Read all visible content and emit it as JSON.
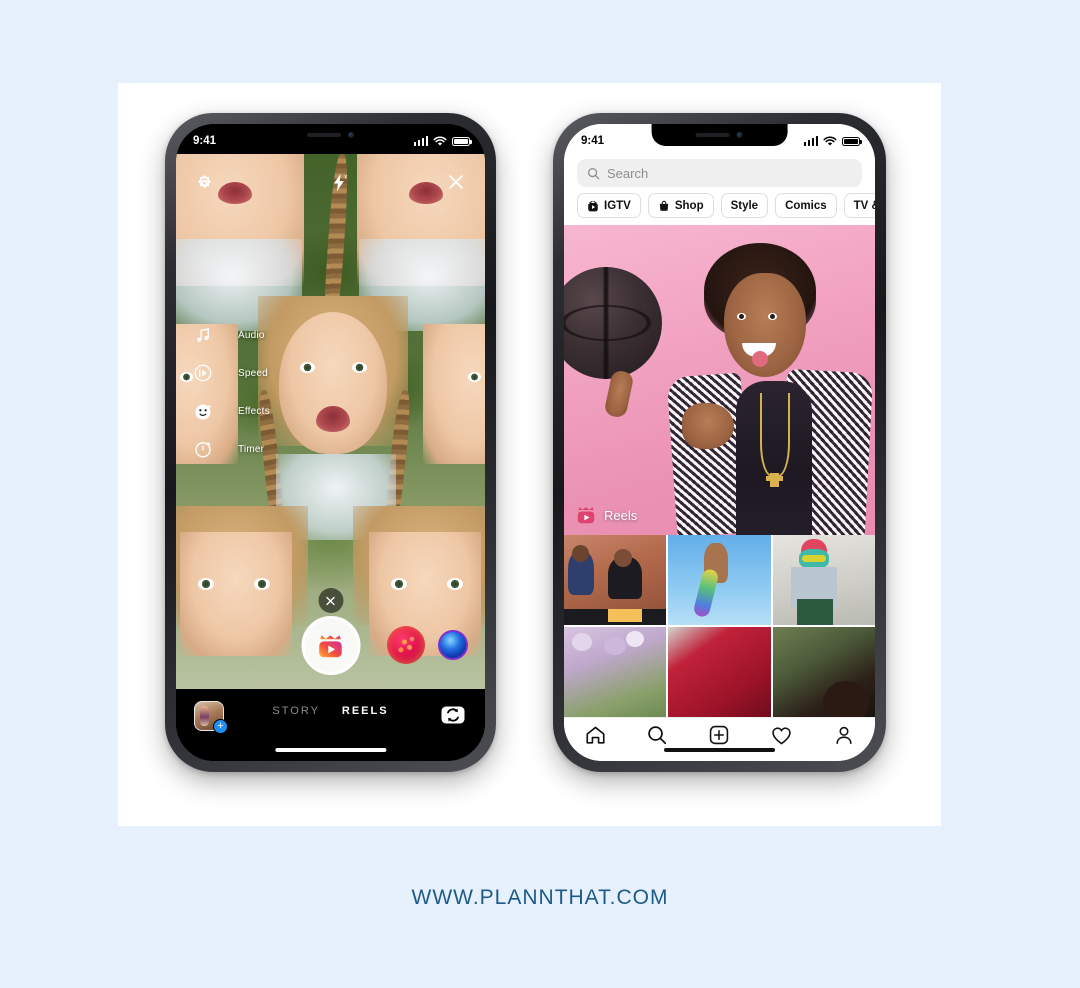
{
  "page": {
    "background_color": "#e7f1fd",
    "card_background": "#ffffff",
    "footer_url": "WWW.PLANNTHAT.COM",
    "footer_color": "#1d5b88"
  },
  "left_phone": {
    "name": "instagram-reels-camera",
    "status_bar": {
      "time": "9:41",
      "signal": "signal-bars-icon",
      "wifi": "wifi-icon",
      "battery": "battery-icon"
    },
    "top_controls": [
      {
        "name": "settings-gear-icon",
        "label": "Settings"
      },
      {
        "name": "flash-off-icon",
        "label": "Flash off"
      },
      {
        "name": "close-icon",
        "label": "Close"
      }
    ],
    "tools": [
      {
        "icon": "audio-icon",
        "label": "Audio"
      },
      {
        "icon": "speed-icon",
        "label": "Speed"
      },
      {
        "icon": "effects-icon",
        "label": "Effects"
      },
      {
        "icon": "timer-icon",
        "label": "Timer"
      }
    ],
    "cancel_button": {
      "name": "cancel-icon",
      "label": "Cancel"
    },
    "shutter": {
      "name": "reels-shutter-button",
      "label": "Record"
    },
    "effects_carousel": [
      {
        "name": "effect-bubble-sparkle",
        "color": "#e2124f"
      },
      {
        "name": "effect-bubble-blue",
        "color": "#1f6de0"
      }
    ],
    "bottom_bar": {
      "gallery_thumb": "gallery-thumbnail",
      "gallery_badge": "+",
      "modes": [
        {
          "label": "STORY",
          "active": false
        },
        {
          "label": "REELS",
          "active": true
        }
      ],
      "flip_camera": "flip-camera-icon"
    }
  },
  "right_phone": {
    "name": "instagram-explore",
    "status_bar": {
      "time": "9:41",
      "signal": "signal-bars-icon",
      "wifi": "wifi-icon",
      "battery": "battery-icon"
    },
    "search": {
      "placeholder": "Search",
      "icon": "search-icon"
    },
    "chips": [
      {
        "label": "IGTV",
        "icon": "igtv-icon"
      },
      {
        "label": "Shop",
        "icon": "shop-bag-icon"
      },
      {
        "label": "Style",
        "icon": ""
      },
      {
        "label": "Comics",
        "icon": ""
      },
      {
        "label": "TV & Movies",
        "icon": ""
      }
    ],
    "hero": {
      "name": "reels-featured-post",
      "badge_label": "Reels",
      "badge_icon": "reels-clapperboard-icon",
      "background_color": "#eb93b4"
    },
    "grid": [
      {
        "name": "grid-cell-craft-couple",
        "c1": "#b35c3b",
        "c2": "#2b3d6b"
      },
      {
        "name": "grid-cell-beaded-hand",
        "c1": "#5aa6e8",
        "c2": "#8fc9f2"
      },
      {
        "name": "grid-cell-street-style",
        "c1": "#cfd6d8",
        "c2": "#4b6b4a"
      },
      {
        "name": "grid-cell-floral",
        "c1": "#c9b3d6",
        "c2": "#6d8a59"
      },
      {
        "name": "grid-cell-red-fabric",
        "c1": "#c0223a",
        "c2": "#7d1225"
      },
      {
        "name": "grid-cell-portrait-dark",
        "c1": "#3a2a22",
        "c2": "#5f6b4a"
      }
    ],
    "nav_items": [
      {
        "name": "nav-home-icon",
        "label": "Home"
      },
      {
        "name": "nav-search-icon",
        "label": "Search"
      },
      {
        "name": "nav-add-icon",
        "label": "Add"
      },
      {
        "name": "nav-activity-icon",
        "label": "Activity"
      },
      {
        "name": "nav-profile-icon",
        "label": "Profile"
      }
    ]
  }
}
